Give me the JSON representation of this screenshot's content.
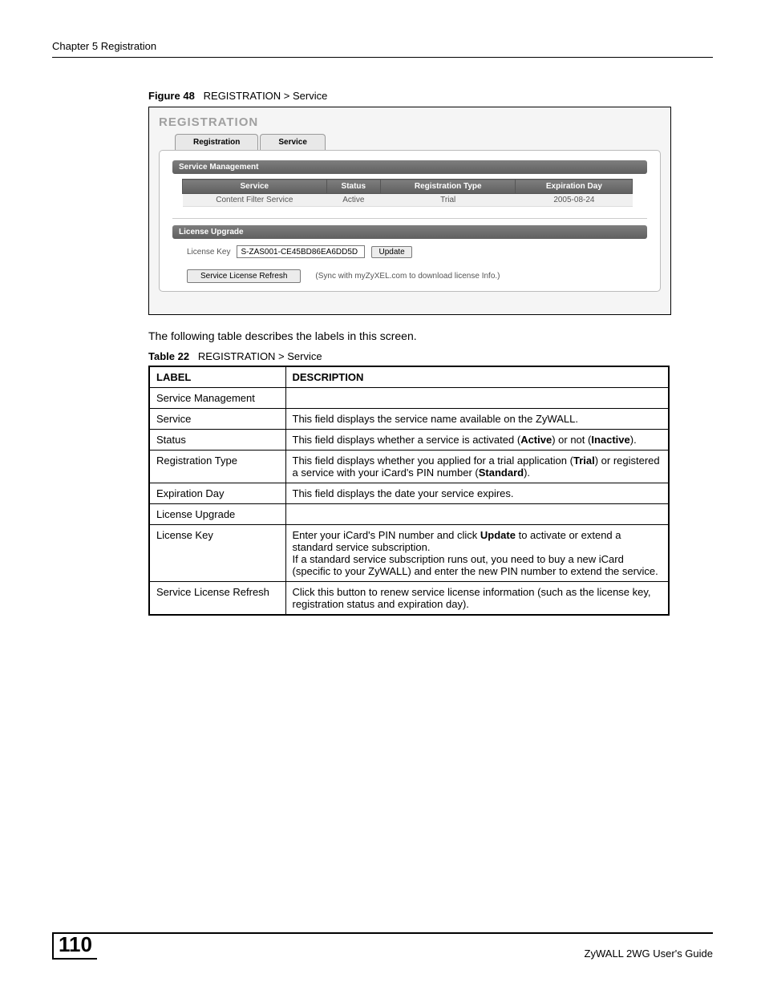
{
  "header": {
    "chapter": "Chapter 5 Registration"
  },
  "figure": {
    "label": "Figure 48",
    "title": "REGISTRATION > Service"
  },
  "screenshot": {
    "title": "REGISTRATION",
    "tabs": {
      "registration": "Registration",
      "service": "Service"
    },
    "section1": {
      "heading": "Service Management",
      "cols": {
        "service": "Service",
        "status": "Status",
        "regtype": "Registration Type",
        "expday": "Expiration Day"
      },
      "rows": [
        {
          "service": "Content Filter Service",
          "status": "Active",
          "regtype": "Trial",
          "expday": "2005-08-24"
        }
      ]
    },
    "section2": {
      "heading": "License Upgrade",
      "license_key_label": "License Key",
      "license_key_value": "S-ZAS001-CE45BD86EA6DD5D",
      "update_btn": "Update",
      "refresh_btn": "Service License Refresh",
      "refresh_hint": "(Sync with myZyXEL.com to download license Info.)"
    }
  },
  "intro": "The following table describes the labels in this screen.",
  "table_caption": {
    "label": "Table 22",
    "title": "REGISTRATION > Service"
  },
  "doc_table": {
    "head": {
      "label": "LABEL",
      "desc": "DESCRIPTION"
    },
    "rows": {
      "r0": {
        "label": "Service Management",
        "desc": ""
      },
      "r1": {
        "label": "Service",
        "desc": "This field displays the service name available on the ZyWALL."
      },
      "r2": {
        "label": "Status",
        "desc_pre": "This field displays whether a service is activated (",
        "desc_b1": "Active",
        "desc_mid": ") or not (",
        "desc_b2": "Inactive",
        "desc_post": ")."
      },
      "r3": {
        "label": "Registration Type",
        "desc_pre": "This field displays whether you applied for a trial application (",
        "desc_b1": "Trial",
        "desc_mid": ") or registered a service with your iCard's PIN number (",
        "desc_b2": "Standard",
        "desc_post": ")."
      },
      "r4": {
        "label": "Expiration Day",
        "desc": "This field displays the date your service expires."
      },
      "r5": {
        "label": "License Upgrade",
        "desc": ""
      },
      "r6": {
        "label": "License Key",
        "p1_pre": "Enter your iCard's PIN number and click ",
        "p1_b": "Update",
        "p1_post": " to activate or extend a standard service subscription.",
        "p2": "If a standard service subscription runs out, you need to buy a new iCard (specific to your ZyWALL) and enter the new PIN number to extend the service."
      },
      "r7": {
        "label": "Service License Refresh",
        "desc": "Click this button to renew service license information (such as the license key, registration status and expiration day)."
      }
    }
  },
  "footer": {
    "page": "110",
    "title": "ZyWALL 2WG User's Guide"
  }
}
